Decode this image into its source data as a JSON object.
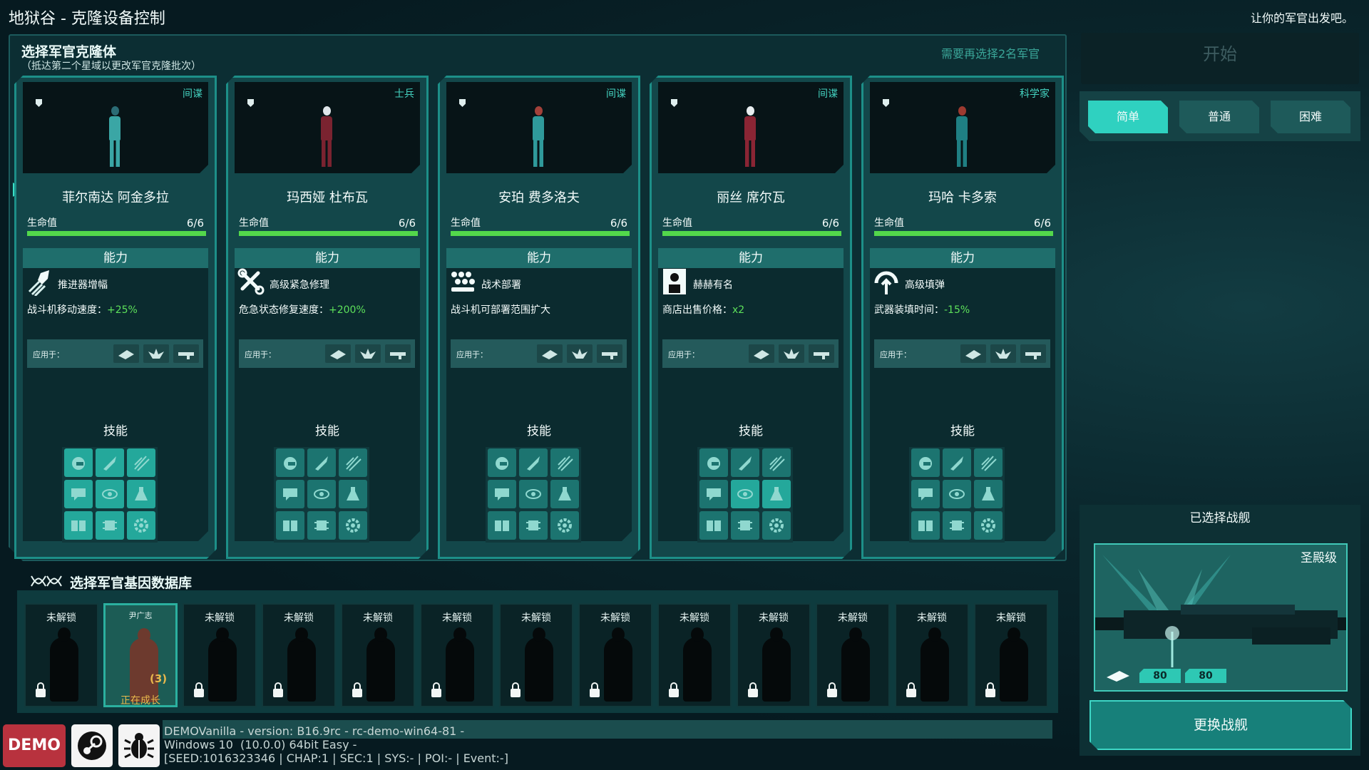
{
  "window_title": "地狱谷 - 克隆设备控制",
  "top_message": "让你的军官出发吧。",
  "clone_panel": {
    "title": "选择军官克隆体",
    "subtitle": "（抵达第二个星域以更改军官克隆批次）",
    "need_more": "需要再选择2名军官"
  },
  "labels": {
    "hp": "生命值",
    "ability": "能力",
    "applies_to": "应用于：",
    "skills": "技能"
  },
  "officers": [
    {
      "class": "间谍",
      "name": "菲尔南达 阿金多拉",
      "hp": "6/6",
      "ability_name": "推进器增幅",
      "ability_desc": "战斗机移动速度：",
      "ability_value": "+25%",
      "body_color": "#3aa6a5",
      "head_color": "#2b6c75"
    },
    {
      "class": "士兵",
      "name": "玛西娅 杜布瓦",
      "hp": "6/6",
      "ability_name": "高级紧急修理",
      "ability_desc": "危急状态修复速度：",
      "ability_value": "+200%",
      "body_color": "#7a2330",
      "head_color": "#dfe6ea"
    },
    {
      "class": "间谍",
      "name": "安珀 费多洛夫",
      "hp": "6/6",
      "ability_name": "战术部署",
      "ability_desc": "战斗机可部署范围扩大",
      "ability_value": "",
      "body_color": "#2f9a9b",
      "head_color": "#a2413a"
    },
    {
      "class": "间谍",
      "name": "丽丝 席尔瓦",
      "hp": "6/6",
      "ability_name": "赫赫有名",
      "ability_desc": "商店出售价格：",
      "ability_value": "x2",
      "body_color": "#8a2534",
      "head_color": "#e8eef0"
    },
    {
      "class": "科学家",
      "name": "玛哈 卡多索",
      "hp": "6/6",
      "ability_name": "高级填弹",
      "ability_desc": "武器装填时间：",
      "ability_value": "-15%",
      "body_color": "#1f7f83",
      "head_color": "#9c3a30"
    }
  ],
  "gene_db": {
    "title": "选择军官基因数据库",
    "slots": [
      {
        "label": "未解锁",
        "state": "locked"
      },
      {
        "label": "尹广志",
        "state": "growing",
        "status": "正在成长",
        "badge": "(3)"
      },
      {
        "label": "未解锁",
        "state": "locked"
      },
      {
        "label": "未解锁",
        "state": "locked"
      },
      {
        "label": "未解锁",
        "state": "locked"
      },
      {
        "label": "未解锁",
        "state": "locked"
      },
      {
        "label": "未解锁",
        "state": "locked"
      },
      {
        "label": "未解锁",
        "state": "locked"
      },
      {
        "label": "未解锁",
        "state": "locked"
      },
      {
        "label": "未解锁",
        "state": "locked"
      },
      {
        "label": "未解锁",
        "state": "locked"
      },
      {
        "label": "未解锁",
        "state": "locked"
      },
      {
        "label": "未解锁",
        "state": "locked"
      }
    ]
  },
  "version_text": "DEMOVanilla - version: B16.9rc - rc-demo-win64-81 -\nWindows 10  (10.0.0) 64bit Easy -\n[SEED:1016323346 | CHAP:1 | SEC:1 | SYS:- | POI:- | Event:-]",
  "buttons": {
    "demo": "DEMO",
    "start": "开始",
    "change_ship": "更换战舰"
  },
  "difficulty": [
    {
      "label": "简单",
      "selected": true
    },
    {
      "label": "普通",
      "selected": false
    },
    {
      "label": "困难",
      "selected": false
    }
  ],
  "ship": {
    "section_title": "已选择战舰",
    "class": "圣殿级",
    "stat1": "80",
    "stat2": "80"
  },
  "colors": {
    "accent": "#2fd1c0",
    "hp_bar": "#53d84b",
    "positive_value": "#5de05a",
    "growing": "#e8b84c",
    "demo": "#b8323e"
  }
}
